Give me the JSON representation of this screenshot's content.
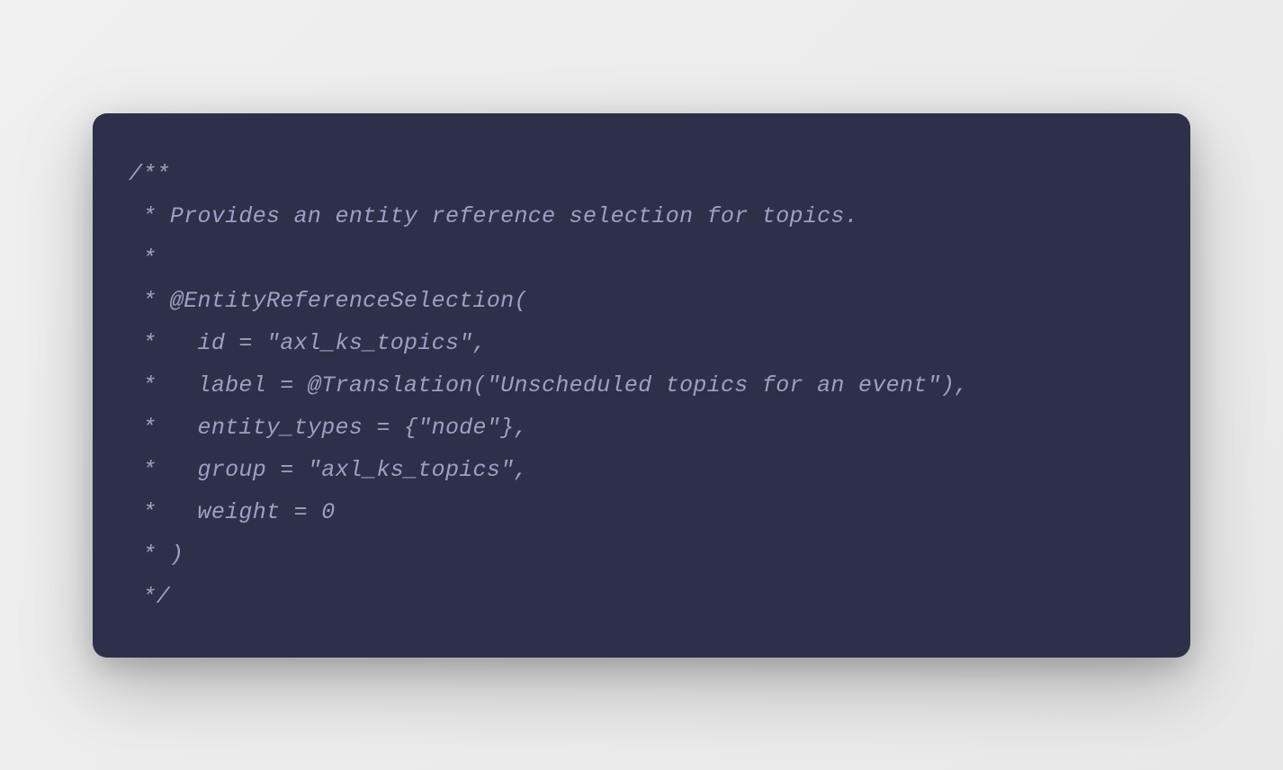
{
  "code": {
    "lines": [
      "/**",
      " * Provides an entity reference selection for topics.",
      " *",
      " * @EntityReferenceSelection(",
      " *   id = \"axl_ks_topics\",",
      " *   label = @Translation(\"Unscheduled topics for an event\"),",
      " *   entity_types = {\"node\"},",
      " *   group = \"axl_ks_topics\",",
      " *   weight = 0",
      " * )",
      " */"
    ]
  }
}
